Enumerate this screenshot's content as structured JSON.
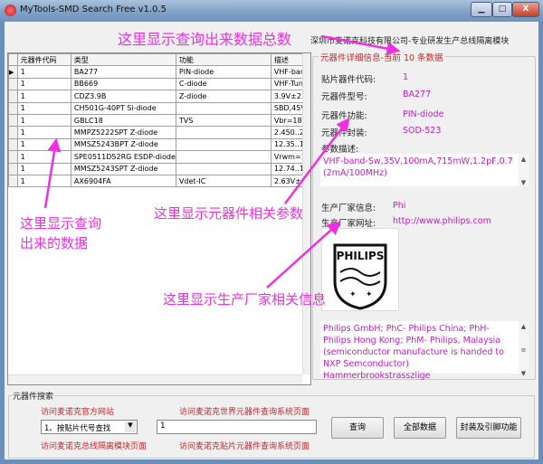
{
  "window": {
    "title": "MyTools-SMD Search Free v1.0.5",
    "min": "▁",
    "max": "□",
    "close": "X"
  },
  "company": "深圳市麦诺克科技有限公司-专业研发生产总线隔离模块",
  "grid": {
    "headers": [
      "元器件代码",
      "类型",
      "功能",
      "描述"
    ],
    "rows": [
      [
        "1",
        "BA277",
        "PIN-diode",
        "VHF-band"
      ],
      [
        "1",
        "BB669",
        "C-diode",
        "VHF-Tun"
      ],
      [
        "1",
        "CDZ3.9B",
        "Z-diode",
        "3.9V±2.5"
      ],
      [
        "1",
        "CH501G-40PT Si-diode",
        "",
        "SBD,45V"
      ],
      [
        "1",
        "GBLC18",
        "TVS",
        "Vbr=18V"
      ],
      [
        "1",
        "MMPZ5222SPT Z-diode",
        "",
        "2.450..2"
      ],
      [
        "1",
        "MMSZ5243BPT Z-diode",
        "",
        "12.35..1"
      ],
      [
        "1",
        "SPE0511D52RG ESDP-diode",
        "",
        "Vrwm=1!"
      ],
      [
        "1",
        "MMSZ5243SPT Z-diode",
        "",
        "12.74..1"
      ],
      [
        "1",
        "AX6904FA",
        "Vdet-IC",
        "2.63V±1"
      ]
    ]
  },
  "detail": {
    "legend": "元器件详细信息-当前 10 条数据",
    "code_label": "贴片器件代码:",
    "code": "1",
    "model_label": "元器件型号:",
    "model": "BA277",
    "function_label": "元器件功能:",
    "function": "PIN-diode",
    "package_label": "元器件封装:",
    "package": "SOD-523",
    "param_label": "参数描述:",
    "params": "VHF-band-Sw,35V,100mA,715mW,1.2pF,0.7 (2mA/100MHz)",
    "maker_label": "生产厂家信息:",
    "maker": "Phi",
    "url_label": "生产厂家网址:",
    "url": "http://www.philips.com",
    "logo_text": "PHILIPS",
    "maker_info": "Philips GmbH; PhC- Philips China; PhH-Philips Hong Kong; PhM- Philips, Malaysia (semiconductor manufacture is handed to NXP Semconductor) Hammerbrookstrasszlige"
  },
  "search": {
    "legend": "元器件搜索",
    "link_official": "访问麦诺克官方网站",
    "link_world": "访问麦诺克世界元器件查询系统页面",
    "link_bus": "访问麦诺克总线隔离模块页面",
    "link_smd": "访问麦诺克贴片元器件查询系统页面",
    "mode": "1、按贴片代号查找",
    "query": "1",
    "btn_query": "查询",
    "btn_all": "全部数据",
    "btn_package": "封装及引脚功能"
  },
  "annotations": {
    "total": "这里显示查询出来数据总数",
    "data1": "这里显示查询",
    "data2": "出来的数据",
    "params": "这里显示元器件相关参数",
    "maker": "这里显示生产厂家相关信息"
  },
  "colors": {
    "annotation": "#f030e0",
    "value": "#c020c0",
    "link": "#c0282d"
  }
}
